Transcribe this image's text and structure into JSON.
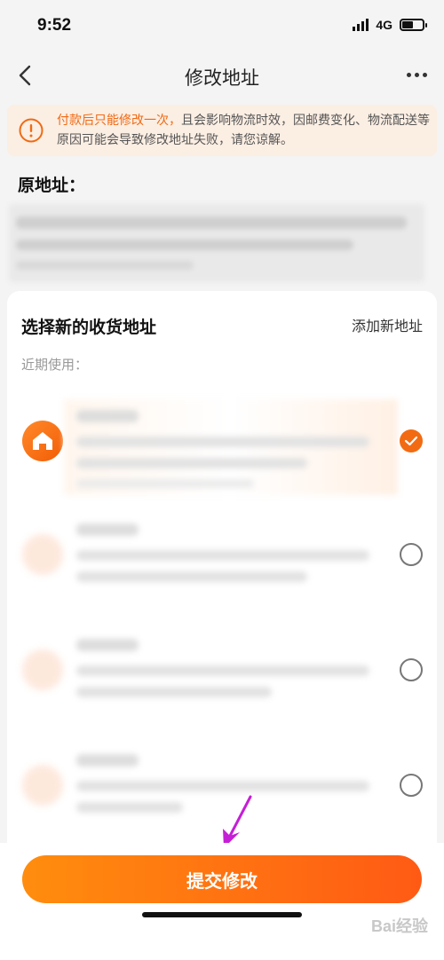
{
  "status": {
    "time": "9:52",
    "network": "4G"
  },
  "nav": {
    "title": "修改地址"
  },
  "notice": {
    "highlight": "付款后只能修改一次，",
    "text": "且会影响物流时效，因邮费变化、物流配送等原因可能会导致修改地址失败，请您谅解。"
  },
  "original": {
    "label": "原地址："
  },
  "panel": {
    "title": "选择新的收货地址",
    "add_new": "添加新地址",
    "recent_label": "近期使用："
  },
  "addresses": [
    {
      "selected": true
    },
    {
      "selected": false
    },
    {
      "selected": false
    },
    {
      "selected": false
    }
  ],
  "submit": {
    "label": "提交修改"
  },
  "watermark": "Bai经验",
  "colors": {
    "accent": "#f26b12",
    "button_start": "#ff8d0e",
    "button_end": "#ff5a14",
    "notice_bg": "#fbeee3"
  }
}
